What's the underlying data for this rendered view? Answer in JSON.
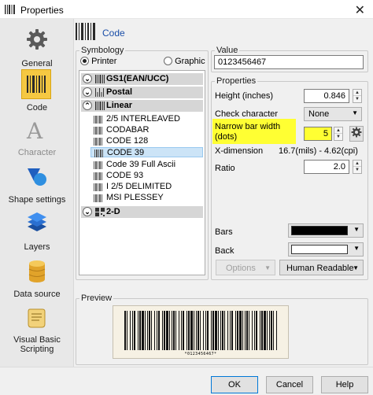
{
  "window": {
    "title": "Properties",
    "close_glyph": "✕"
  },
  "sidebar": {
    "items": [
      {
        "label": "General",
        "icon": "gear-icon"
      },
      {
        "label": "Code",
        "icon": "barcode-icon",
        "selected": true
      },
      {
        "label": "Character",
        "icon": "letter-a-icon",
        "disabled": true
      },
      {
        "label": "Shape settings",
        "icon": "shapes-icon"
      },
      {
        "label": "Layers",
        "icon": "layers-icon"
      },
      {
        "label": "Data source",
        "icon": "database-icon"
      },
      {
        "label": "Visual Basic Scripting",
        "icon": "scroll-icon"
      }
    ]
  },
  "header": {
    "label": "Code"
  },
  "symbology": {
    "legend": "Symbology",
    "printer_label": "Printer",
    "graphic_label": "Graphic",
    "selected_mode": "Printer",
    "groups": [
      {
        "label": "GS1(EAN/UCC)",
        "toggle": "⌄",
        "expanded": false
      },
      {
        "label": "Postal",
        "toggle": "⌄",
        "expanded": false
      },
      {
        "label": "Linear",
        "toggle": "⌃",
        "expanded": true
      },
      {
        "label": "2-D",
        "toggle": "⌄",
        "expanded": false
      }
    ],
    "linear_items": [
      "2/5 INTERLEAVED",
      "CODABAR",
      "CODE 128",
      "CODE 39",
      "Code 39 Full Ascii",
      "CODE 93",
      "I 2/5 DELIMITED",
      "MSI PLESSEY"
    ],
    "selected_item": "CODE 39"
  },
  "value": {
    "legend": "Value",
    "text": "0123456467"
  },
  "properties": {
    "legend": "Properties",
    "height_label": "Height (inches)",
    "height_value": "0.846",
    "check_label": "Check character",
    "check_value": "None",
    "narrow_label_1": "Narrow bar width",
    "narrow_label_2": "(dots)",
    "narrow_value": "5",
    "xdim_label": "X-dimension",
    "xdim_value": "16.7(mils) - 4.62(cpi)",
    "ratio_label": "Ratio",
    "ratio_value": "2.0",
    "bars_label": "Bars",
    "back_label": "Back",
    "bars_color": "#000000",
    "back_color": "#ffffff",
    "options_label": "Options",
    "human_readable_label": "Human Readable",
    "highlight_color": "#ffff33"
  },
  "preview": {
    "legend": "Preview",
    "human_text": "*0123456467*"
  },
  "buttons": {
    "ok": "OK",
    "cancel": "Cancel",
    "help": "Help"
  }
}
